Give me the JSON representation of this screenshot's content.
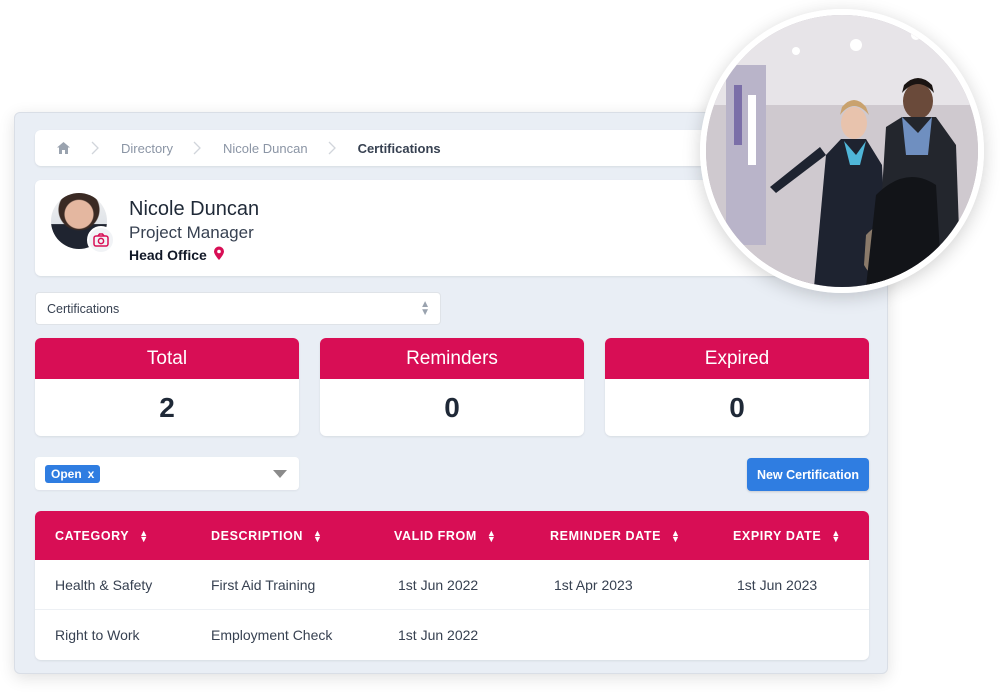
{
  "colors": {
    "accent": "#d80e55",
    "primary": "#2f7de1",
    "background": "#e9eef5"
  },
  "breadcrumb": {
    "home_icon": "home-icon",
    "items": [
      "Directory",
      "Nicole Duncan",
      "Certifications"
    ]
  },
  "profile": {
    "name": "Nicole Duncan",
    "role": "Project Manager",
    "office": "Head Office",
    "camera_icon": "camera-icon",
    "location_icon": "map-pin-icon"
  },
  "section_select": {
    "value": "Certifications"
  },
  "stats": [
    {
      "label": "Total",
      "value": "2"
    },
    {
      "label": "Reminders",
      "value": "0"
    },
    {
      "label": "Expired",
      "value": "0"
    }
  ],
  "filter": {
    "tag": "Open",
    "tag_remove": "x"
  },
  "new_button": {
    "label": "New Certification"
  },
  "table": {
    "headers": [
      "CATEGORY",
      "DESCRIPTION",
      "VALID FROM",
      "REMINDER DATE",
      "EXPIRY DATE"
    ],
    "rows": [
      [
        "Health & Safety",
        "First Aid Training",
        "1st Jun 2022",
        "1st Apr 2023",
        "1st Jun 2023"
      ],
      [
        "Right to Work",
        "Employment Check",
        "1st Jun 2022",
        "",
        ""
      ]
    ]
  }
}
